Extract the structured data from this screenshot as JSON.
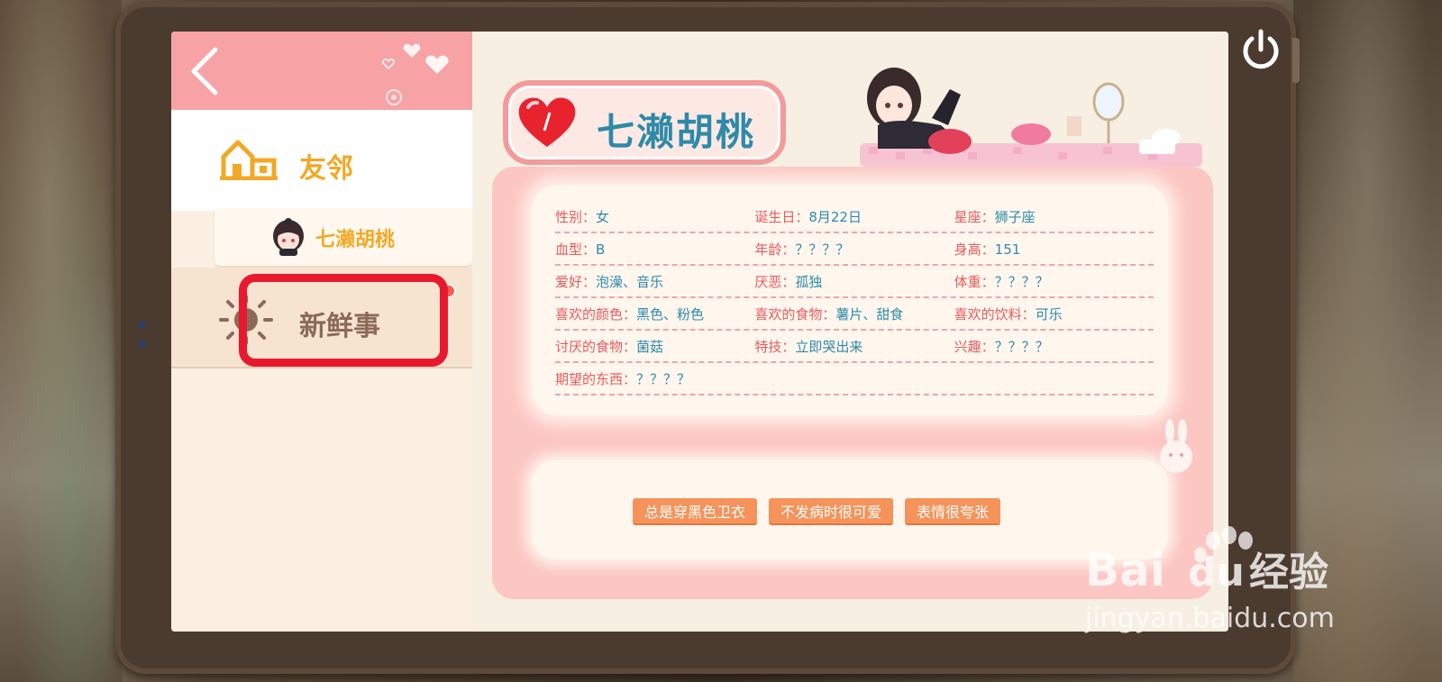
{
  "sidebar": {
    "nav_friends": "友邻",
    "nav_character": "七濑胡桃",
    "nav_news": "新鲜事"
  },
  "profile": {
    "name": "七濑胡桃",
    "rows": [
      [
        {
          "key": "性别：",
          "val": "女"
        },
        {
          "key": "诞生日：",
          "val": "8月22日"
        },
        {
          "key": "星座：",
          "val": "狮子座"
        }
      ],
      [
        {
          "key": "血型：",
          "val": "B"
        },
        {
          "key": "年龄：",
          "val": "？？？？"
        },
        {
          "key": "身高：",
          "val": "151"
        }
      ],
      [
        {
          "key": "爱好：",
          "val": "泡澡、音乐"
        },
        {
          "key": "厌恶：",
          "val": "孤独"
        },
        {
          "key": "体重：",
          "val": "？？？？"
        }
      ],
      [
        {
          "key": "喜欢的颜色：",
          "val": "黑色、粉色"
        },
        {
          "key": "喜欢的食物：",
          "val": "薯片、甜食"
        },
        {
          "key": "喜欢的饮料：",
          "val": "可乐"
        }
      ],
      [
        {
          "key": "讨厌的食物：",
          "val": "菌菇"
        },
        {
          "key": "特技：",
          "val": "立即哭出来"
        },
        {
          "key": "兴趣：",
          "val": "？？？？"
        }
      ],
      [
        {
          "key": "期望的东西：",
          "val": "？？？？"
        }
      ]
    ],
    "tags": [
      "总是穿黑色卫衣",
      "不发病时很可爱",
      "表情很夸张"
    ]
  },
  "watermark": {
    "brand_left": "Bai",
    "brand_right": "经验",
    "url": "jingyan.baidu.com"
  },
  "colors": {
    "accent_pink": "#f7a3a6",
    "name_blue": "#2e8aa8",
    "key_red": "#e85a5d",
    "tag_orange": "#f5935a",
    "highlight_red": "#e8192e"
  },
  "icons": [
    "back-icon",
    "house-icon",
    "avatar-icon",
    "sun-icon",
    "heart-icon",
    "power-icon",
    "paw-icon"
  ]
}
